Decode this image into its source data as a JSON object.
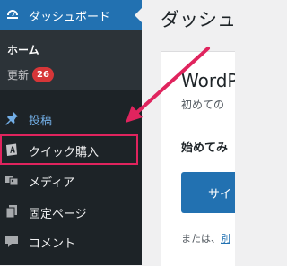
{
  "sidebar": {
    "dashboard": {
      "label": "ダッシュボード",
      "icon": "dashboard-gauge-icon"
    },
    "submenu": {
      "home": "ホーム",
      "updates": "更新",
      "updates_badge": "26"
    },
    "items": [
      {
        "label": "投稿",
        "icon": "pushpin-icon",
        "color": "#72aee6"
      },
      {
        "label": "クイック購入",
        "icon": "quick-purchase-icon",
        "highlighted": true
      },
      {
        "label": "メディア",
        "icon": "media-icon"
      },
      {
        "label": "固定ページ",
        "icon": "page-icon"
      },
      {
        "label": "コメント",
        "icon": "comment-icon"
      }
    ]
  },
  "main": {
    "heading": "ダッシュ",
    "panel": {
      "title": "WordP",
      "subtitle": "初めての",
      "section_heading": "始めてみ",
      "button_label": "サイ",
      "or_text": "または、",
      "or_link": "別"
    }
  },
  "annotation": {
    "arrow_color": "#e0245e",
    "highlight_color": "#e0245e"
  },
  "colors": {
    "sidebar_bg": "#1d2327",
    "submenu_bg": "#2c3338",
    "accent": "#2271b1",
    "badge": "#d63638"
  }
}
